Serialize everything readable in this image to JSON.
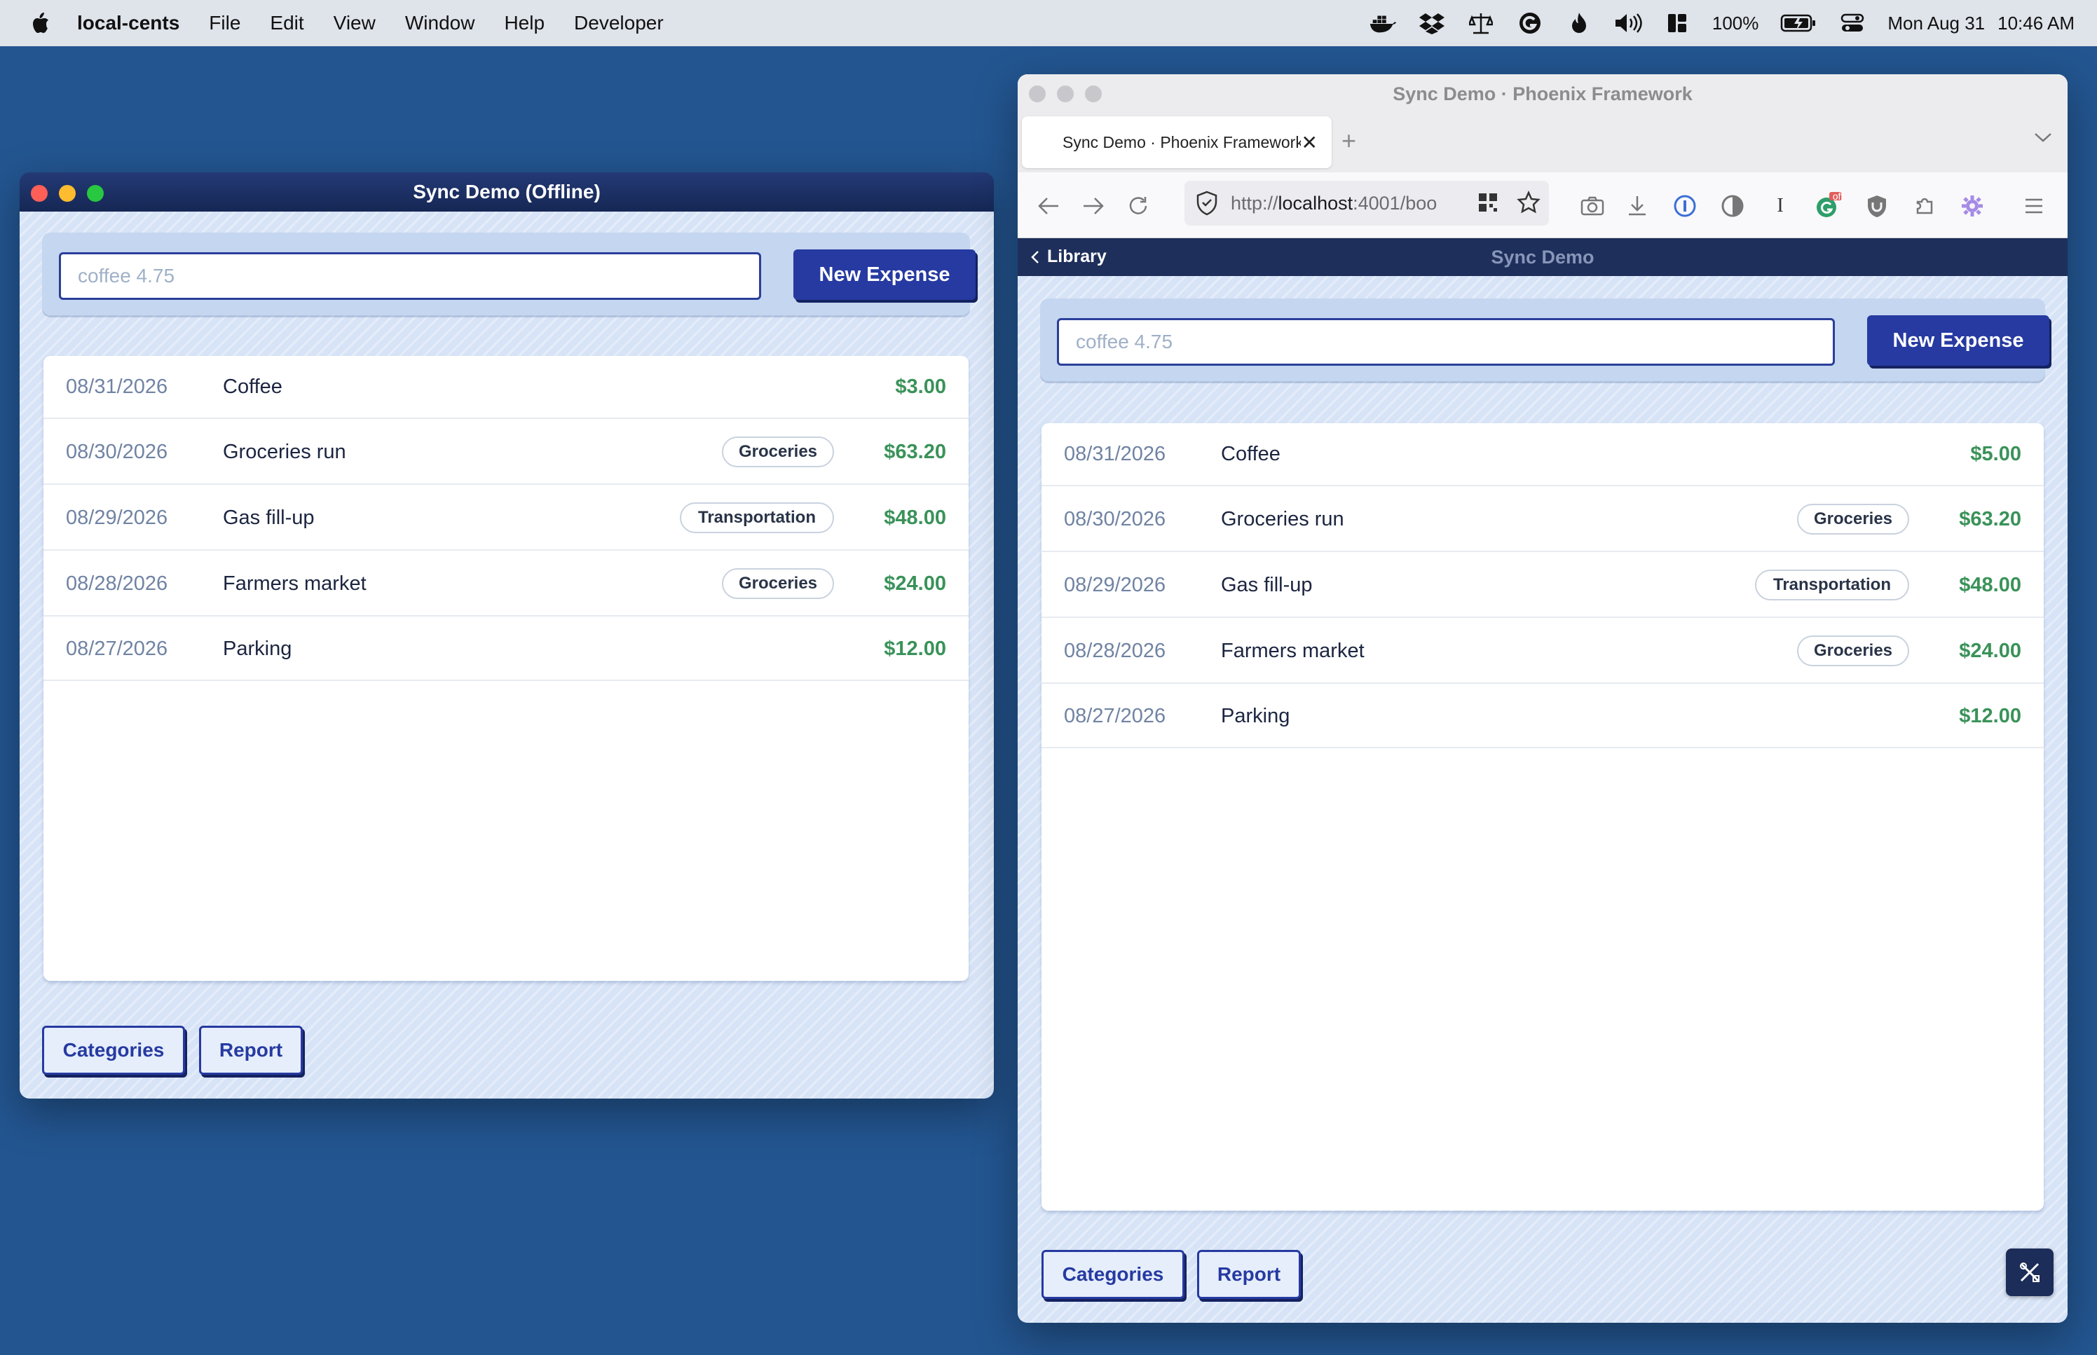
{
  "menubar": {
    "app_name": "local-cents",
    "menus": [
      "File",
      "Edit",
      "View",
      "Window",
      "Help",
      "Developer"
    ],
    "battery": "100%",
    "date": "Mon Aug 31",
    "time": "10:46 AM"
  },
  "desktop_window": {
    "title": "Sync Demo (Offline)",
    "input_placeholder": "coffee 4.75",
    "new_expense_label": "New Expense",
    "expenses": [
      {
        "date": "08/31/2026",
        "description": "Coffee",
        "category": "",
        "amount": "$3.00"
      },
      {
        "date": "08/30/2026",
        "description": "Groceries run",
        "category": "Groceries",
        "amount": "$63.20"
      },
      {
        "date": "08/29/2026",
        "description": "Gas fill-up",
        "category": "Transportation",
        "amount": "$48.00"
      },
      {
        "date": "08/28/2026",
        "description": "Farmers market",
        "category": "Groceries",
        "amount": "$24.00"
      },
      {
        "date": "08/27/2026",
        "description": "Parking",
        "category": "",
        "amount": "$12.00"
      }
    ],
    "categories_label": "Categories",
    "report_label": "Report"
  },
  "browser_window": {
    "window_title": "Sync Demo · Phoenix Framework",
    "tab_title": "Sync Demo · Phoenix Framework",
    "url_scheme": "http://",
    "url_host": "localhost",
    "url_rest": ":4001/boo",
    "extension_badge": "off",
    "header_back_label": "Library",
    "header_title": "Sync Demo",
    "input_placeholder": "coffee 4.75",
    "new_expense_label": "New Expense",
    "expenses": [
      {
        "date": "08/31/2026",
        "description": "Coffee",
        "category": "",
        "amount": "$5.00"
      },
      {
        "date": "08/30/2026",
        "description": "Groceries run",
        "category": "Groceries",
        "amount": "$63.20"
      },
      {
        "date": "08/29/2026",
        "description": "Gas fill-up",
        "category": "Transportation",
        "amount": "$48.00"
      },
      {
        "date": "08/28/2026",
        "description": "Farmers market",
        "category": "Groceries",
        "amount": "$24.00"
      },
      {
        "date": "08/27/2026",
        "description": "Parking",
        "category": "",
        "amount": "$12.00"
      }
    ],
    "categories_label": "Categories",
    "report_label": "Report"
  },
  "colors": {
    "desktop_bg": "#235590",
    "primary": "#263aa1",
    "amount": "#3a9259",
    "header": "#1e2f5c"
  },
  "icons": [
    "apple-icon",
    "docker-icon",
    "dropbox-icon",
    "grammarly-icon",
    "flame-icon",
    "volume-icon",
    "battery-icon",
    "control-center-icon",
    "shield-icon",
    "star-icon",
    "camera-icon",
    "download-icon",
    "reload-icon",
    "hamburger-menu-icon",
    "tools-icon"
  ]
}
